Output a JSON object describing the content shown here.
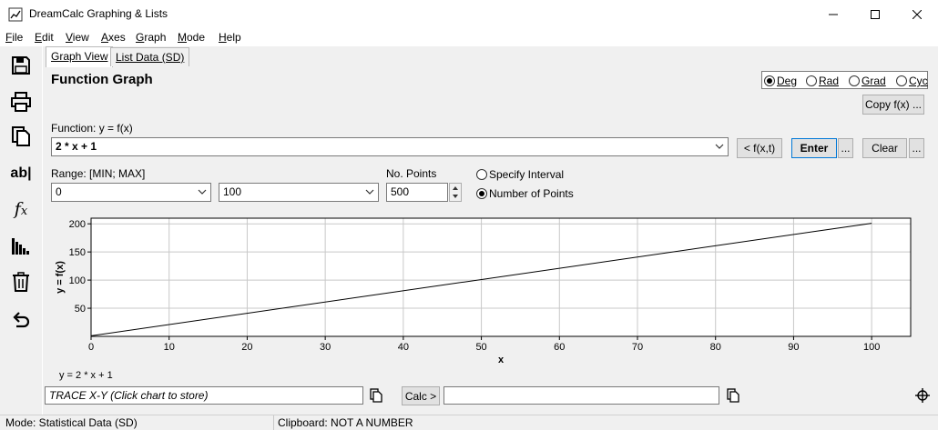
{
  "window": {
    "title": "DreamCalc Graphing & Lists",
    "minimize_icon": "minimize-icon",
    "maximize_icon": "maximize-icon",
    "close_icon": "close-icon"
  },
  "menu": [
    {
      "label": "File",
      "accel": "F",
      "rest": "ile"
    },
    {
      "label": "Edit",
      "accel": "E",
      "rest": "dit"
    },
    {
      "label": "View",
      "accel": "V",
      "rest": "iew"
    },
    {
      "label": "Axes",
      "accel": "A",
      "rest": "xes"
    },
    {
      "label": "Graph",
      "accel": "G",
      "rest": "raph"
    },
    {
      "label": "Mode",
      "accel": "M",
      "rest": "ode"
    },
    {
      "label": "Help",
      "accel": "H",
      "rest": "elp"
    }
  ],
  "toolbar": {
    "icons": [
      "save-icon",
      "print-icon",
      "copy-icon",
      "text-label-icon",
      "function-icon",
      "histogram-icon",
      "delete-icon",
      "undo-icon"
    ],
    "text_label": "ab|",
    "function_label": "fx"
  },
  "tabs": {
    "graph_view": "Graph View",
    "list_data": "List Data (SD)"
  },
  "panel": {
    "title": "Function Graph",
    "angle_modes": [
      {
        "label": "Deg",
        "selected": true
      },
      {
        "label": "Rad",
        "selected": false
      },
      {
        "label": "Grad",
        "selected": false
      },
      {
        "label": "Cyc",
        "selected": false
      }
    ],
    "copy_button": "Copy f(x) ...",
    "function_label": "Function: y = f(x)",
    "function_value": "2 * x + 1",
    "fxt_button": "< f(x,t)",
    "enter_button": "Enter",
    "more_button": "...",
    "clear_button": "Clear",
    "range_label": "Range: [MIN; MAX]",
    "range_min": "0",
    "range_max": "100",
    "points_label": "No. Points",
    "points_value": "500",
    "mode_specify_interval": "Specify Interval",
    "mode_number_points": "Number of Points",
    "mode_selected": "Number of Points"
  },
  "chart_data": {
    "type": "line",
    "series": [
      {
        "name": "y = 2 * x + 1",
        "x": [
          0,
          100
        ],
        "y": [
          1,
          201
        ]
      }
    ],
    "xlabel": "x",
    "ylabel": "y = f(x)",
    "xlim": [
      0,
      105
    ],
    "ylim": [
      0,
      210
    ],
    "xticks": [
      0,
      10,
      20,
      30,
      40,
      50,
      60,
      70,
      80,
      90,
      100
    ],
    "yticks": [
      50,
      100,
      150,
      200
    ],
    "grid": true,
    "legend_text": "y = 2 * x + 1"
  },
  "trace": {
    "placeholder": "TRACE X-Y (Click chart to store)",
    "calc_button": "Calc >",
    "calc_value": ""
  },
  "statusbar": {
    "mode": "Mode: Statistical Data (SD)",
    "clipboard": "Clipboard: NOT A NUMBER"
  }
}
